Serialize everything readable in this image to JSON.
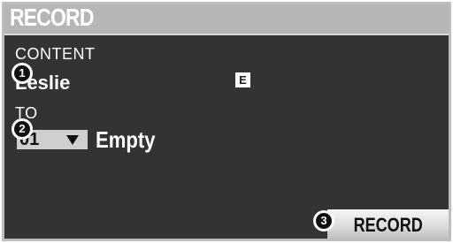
{
  "title": "RECORD",
  "content": {
    "label": "CONTENT",
    "value": "Leslie",
    "badge": "E"
  },
  "to": {
    "label": "TO",
    "selected": "01",
    "status": "Empty"
  },
  "record_button": "RECORD",
  "callouts": [
    "1",
    "2",
    "3"
  ]
}
